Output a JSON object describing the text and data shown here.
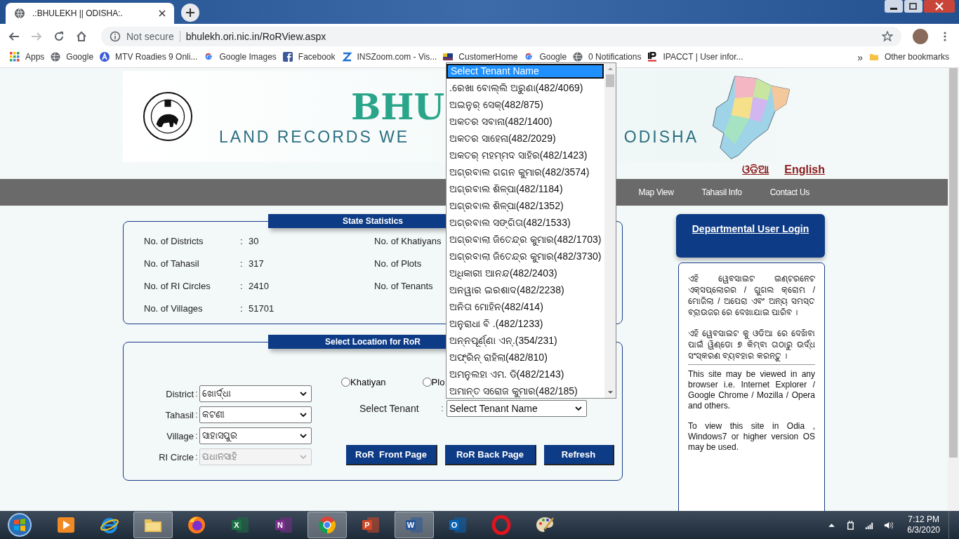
{
  "browser": {
    "tab_title": ".:BHULEKH || ODISHA:.",
    "security": "Not secure",
    "url": "bhulekh.ori.nic.in/RoRView.aspx",
    "bookmarks": [
      {
        "label": "Apps"
      },
      {
        "label": "Google"
      },
      {
        "label": "MTV Roadies 9 Onli..."
      },
      {
        "label": "Google Images"
      },
      {
        "label": "Facebook"
      },
      {
        "label": "INSZoom.com - Vis..."
      },
      {
        "label": "CustomerHome"
      },
      {
        "label": "Google"
      },
      {
        "label": "0 Notifications"
      },
      {
        "label": "IPACCT | User infor..."
      }
    ],
    "overflow": "»",
    "other_bookmarks": "Other bookmarks"
  },
  "header": {
    "logo_word": "BHU",
    "title_left": "LAND RECORDS WE",
    "title_right": "ODISHA"
  },
  "languages": [
    {
      "label": "ଓଡିଆ"
    },
    {
      "label": "English"
    }
  ],
  "nav": [
    {
      "label": "Map View"
    },
    {
      "label": "Tahasil Info"
    },
    {
      "label": "Contact Us"
    }
  ],
  "state_statistics": {
    "title": "State Statistics",
    "separator": ":",
    "left": [
      {
        "label": "No. of Districts",
        "value": "30"
      },
      {
        "label": "No. of Tahasil",
        "value": "317"
      },
      {
        "label": "No. of RI Circles",
        "value": "2410"
      },
      {
        "label": "No. of Villages",
        "value": "51701"
      }
    ],
    "right": [
      {
        "label": "No. of Khatiyans"
      },
      {
        "label": "No. of Plots"
      },
      {
        "label": "No. of Tenants"
      }
    ]
  },
  "location": {
    "title": "Select Location for RoR",
    "separator": ":",
    "fields": [
      {
        "label": "District",
        "value": "ଖୋର୍ଦ୍ଧା",
        "disabled": false
      },
      {
        "label": "Tahasil",
        "value": "କଟଣୀ",
        "disabled": false
      },
      {
        "label": "Village",
        "value": "ସାହାସପୁର",
        "disabled": false
      },
      {
        "label": "RI Circle",
        "value": "ପଧାନସାହି",
        "disabled": true
      }
    ],
    "search_by": [
      {
        "label": "Khatiyan",
        "selected": false
      },
      {
        "label": "Plo",
        "selected": false
      }
    ],
    "tenant": {
      "label": "Select Tenant",
      "value": "Select Tenant Name"
    },
    "buttons": [
      "RoR  Front Page",
      "RoR Back Page",
      "Refresh"
    ]
  },
  "tenant_dropdown": {
    "options": [
      {
        "label": "Select Tenant Name",
        "selected": true
      },
      {
        "label": ".ରେଖା ବୋଲ୍ଲି ଅରୁଣା(482/4069)",
        "selected": false
      },
      {
        "label": "ଅଇନୁର୍ ସେକ୍(482/875)",
        "selected": false
      },
      {
        "label": "ଅକତର ସବାନା(482/1400)",
        "selected": false
      },
      {
        "label": "ଅକତର ସାହେନା(482/2029)",
        "selected": false
      },
      {
        "label": "ଅକତର୍ ମହମ୍ମଦ ସାହିର(482/1423)",
        "selected": false
      },
      {
        "label": "ଅଗ୍ରବାଲ ଗଗନ କୁମାର(482/3574)",
        "selected": false
      },
      {
        "label": "ଅଗ୍ରବାଲ ଶିଳ୍ପା(482/1184)",
        "selected": false
      },
      {
        "label": "ଅଗ୍ରବାଲ ଶିଳ୍ପା(482/1352)",
        "selected": false
      },
      {
        "label": "ଅଗ୍ରବାଲ ସଙ୍ଗିତା(482/1533)",
        "selected": false
      },
      {
        "label": "ଅଗ୍ରବାଲା ଜିତେନ୍ଦ୍ର କୁମାର(482/1703)",
        "selected": false
      },
      {
        "label": "ଅଗ୍ରବାଲା ଜିତେନ୍ଦ୍ର କୁମାର(482/3730)",
        "selected": false
      },
      {
        "label": "ଅଧିକାରୀ ଆନନ୍ଦ(482/2403)",
        "selected": false
      },
      {
        "label": "ଅନୱାର ଇରଶାଦ(482/2238)",
        "selected": false
      },
      {
        "label": "ଅନିତା ମୋହିନ(482/414)",
        "selected": false
      },
      {
        "label": "ଅନୁରାଧା ବି .(482/1233)",
        "selected": false
      },
      {
        "label": "ଅନ୍ନପୂର୍ଣ୍ଣା ଏନ୍.(354/231)",
        "selected": false
      },
      {
        "label": "ଅଫ୍ରିନ୍ ରାହିଲା(482/810)",
        "selected": false
      },
      {
        "label": "ଅମନୁଲହା ଏମ. ଡି(482/2143)",
        "selected": false
      },
      {
        "label": "ଅମାନ୍ତ ସରୋଜ କୁମାର(482/185)",
        "selected": false
      }
    ]
  },
  "login": {
    "title": "Departmental User Login"
  },
  "notice": {
    "odia": [
      "ଏହି ୱେବସାଇଟ ଇଣ୍ଟରନେଟ ଏକ୍ସପ୍ଲୋରର / ଗୁଗଲ କ୍ରୋମ / ମୋଜିଲା / ଅପେରା ଏବଂ ଅନ୍ୟ ସମସ୍ତ ବ୍ରାଉଜର ରେ ଦେଖାଯାଇ ପାରିବ ।",
      "ଏହି ୱେବସାଇଟ କୁ ଓଡିଆ ରେ ଦେଖିବା ପାଇଁ ୱିଣ୍ଡୋ ୭ କିମ୍ବା ତାଠାରୁ ଉର୍ଦ୍ଧ ସଂସ୍କରଣ ବ୍ୟବହାର କରନ୍ତୁ ।"
    ],
    "english": [
      "This site may be viewed in any browser i.e. Internet Explorer / Google Chrome / Mozilla / Opera and others.",
      "To view this site in Odia , Windows7 or higher version OS may be used."
    ]
  },
  "taskbar": {
    "apps": [
      {
        "kind": "media",
        "running": false
      },
      {
        "kind": "ie",
        "running": false
      },
      {
        "kind": "folder",
        "running": true
      },
      {
        "kind": "firefox",
        "running": false
      },
      {
        "kind": "excel",
        "running": false,
        "letter": "X"
      },
      {
        "kind": "onenote",
        "running": false,
        "letter": "N"
      },
      {
        "kind": "chrome",
        "running": true
      },
      {
        "kind": "powerpoint",
        "running": false,
        "letter": "P"
      },
      {
        "kind": "word",
        "running": true,
        "letter": "W"
      },
      {
        "kind": "outlook",
        "running": false,
        "letter": "O"
      },
      {
        "kind": "opera",
        "running": false
      },
      {
        "kind": "paint",
        "running": false
      }
    ],
    "time": "7:12 PM",
    "date": "6/3/2020"
  }
}
